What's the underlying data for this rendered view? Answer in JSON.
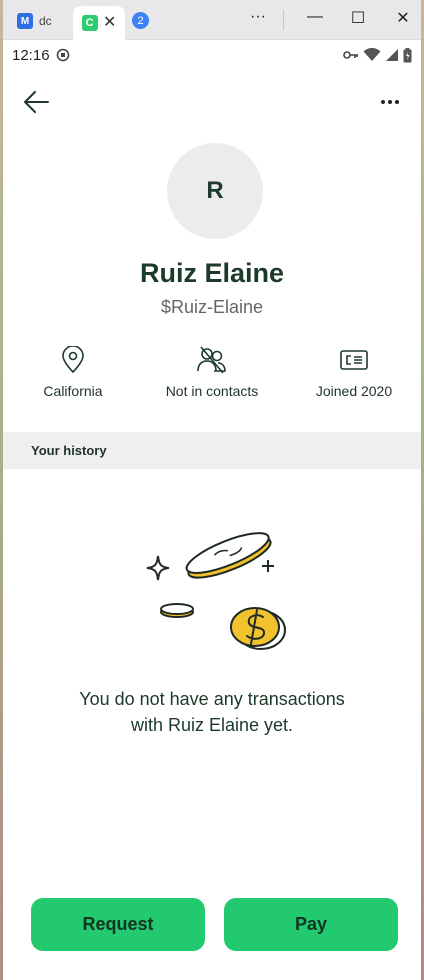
{
  "browser": {
    "tab1_label": "dc",
    "tab1_favicon": "M",
    "tab2_favicon": "C",
    "tab_close": "✕",
    "tab_count": "2",
    "more": "···",
    "minimize": "—",
    "maximize": "☐",
    "close": "✕"
  },
  "status_bar": {
    "time": "12:16"
  },
  "profile": {
    "initial": "R",
    "name": "Ruiz Elaine",
    "cashtag": "$Ruiz-Elaine",
    "info": {
      "location": "California",
      "contacts": "Not in contacts",
      "joined": "Joined 2020"
    }
  },
  "history": {
    "header": "Your history",
    "empty_line1": "You do not have any transactions",
    "empty_line2": "with Ruiz Elaine yet."
  },
  "actions": {
    "request": "Request",
    "pay": "Pay"
  },
  "colors": {
    "accent": "#22c96f",
    "dark_green": "#1c3a2a",
    "coin": "#f2c12e"
  }
}
